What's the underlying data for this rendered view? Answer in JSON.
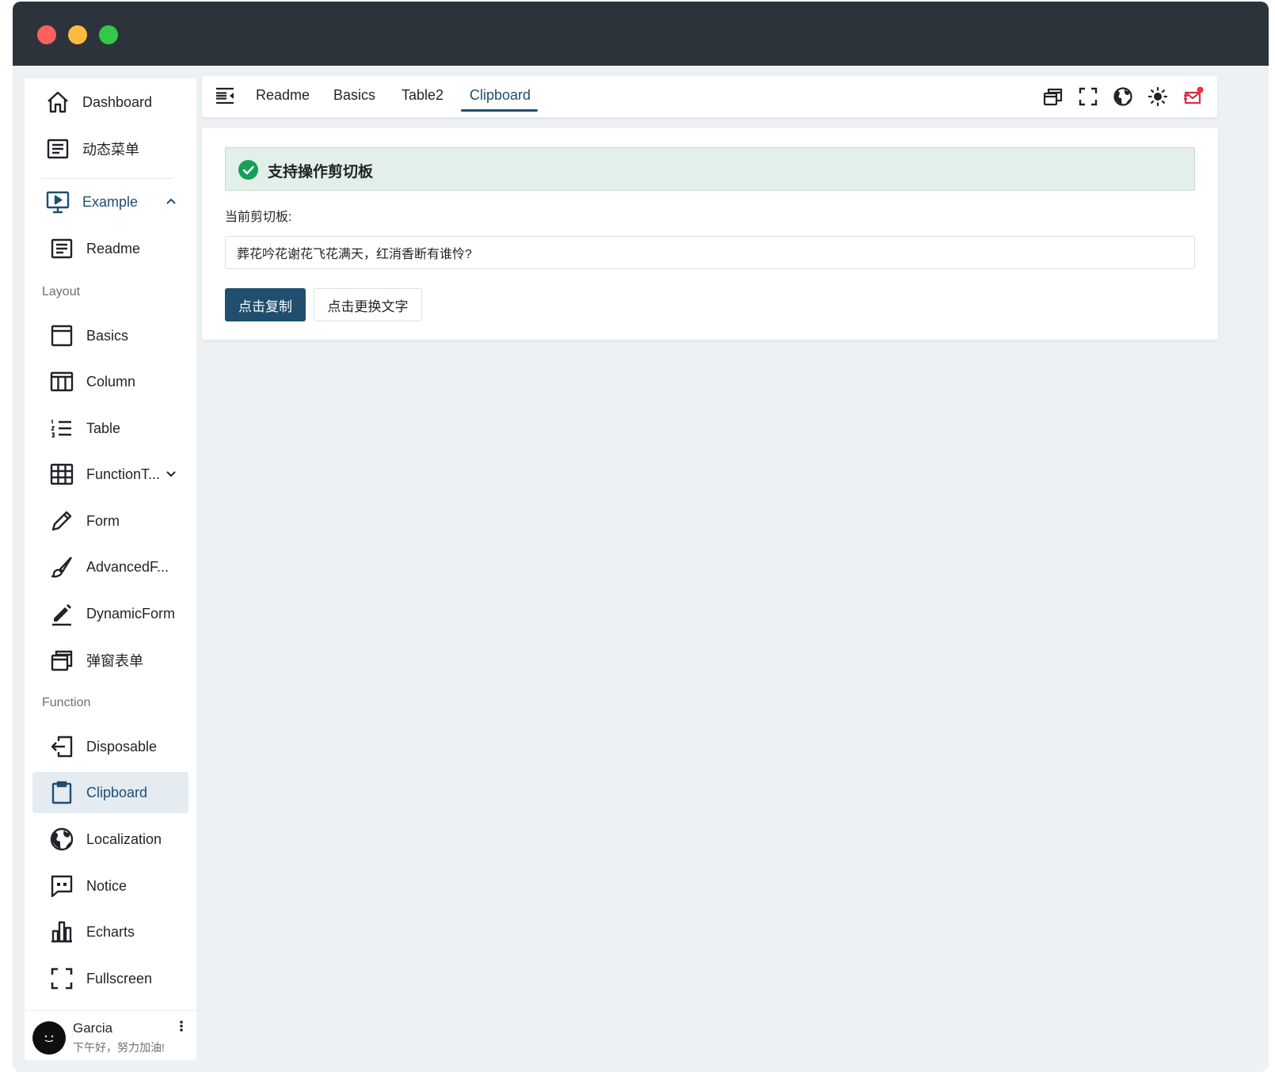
{
  "colors": {
    "accent": "#1f4e6e",
    "titlebar": "#2d333b",
    "background": "#edf1f4",
    "success": "#15a05a",
    "notify": "#e53935"
  },
  "sidebar": {
    "top_items": [
      {
        "label": "Dashboard",
        "icon": "home-icon"
      },
      {
        "label": "动态菜单",
        "icon": "document-icon"
      }
    ],
    "example": {
      "label": "Example",
      "icon": "presentation-icon",
      "expanded": true
    },
    "readme": {
      "label": "Readme",
      "icon": "document-icon"
    },
    "sections": {
      "layout": "Layout",
      "function": "Function"
    },
    "layout_items": [
      {
        "label": "Basics",
        "icon": "window-icon"
      },
      {
        "label": "Column",
        "icon": "columns-icon"
      },
      {
        "label": "Table",
        "icon": "numbered-list-icon"
      },
      {
        "label": "FunctionT...",
        "icon": "grid-icon"
      },
      {
        "label": "Form",
        "icon": "pencil-icon"
      },
      {
        "label": "AdvancedF...",
        "icon": "brush-icon"
      },
      {
        "label": "DynamicForm",
        "icon": "edit-icon"
      },
      {
        "label": "弹窗表单",
        "icon": "windows-icon"
      }
    ],
    "function_items": [
      {
        "label": "Disposable",
        "icon": "logout-icon"
      },
      {
        "label": "Clipboard",
        "icon": "clipboard-icon",
        "active": true
      },
      {
        "label": "Localization",
        "icon": "globe-icon"
      },
      {
        "label": "Notice",
        "icon": "message-icon"
      },
      {
        "label": "Echarts",
        "icon": "bar-chart-icon"
      },
      {
        "label": "Fullscreen",
        "icon": "fullscreen-icon"
      }
    ],
    "user": {
      "name": "Garcia",
      "greeting": "下午好，努力加油!"
    }
  },
  "topbar": {
    "tabs": [
      "Readme",
      "Basics",
      "Table2",
      "Clipboard"
    ],
    "active_tab": "Clipboard",
    "tools": [
      "windows-icon",
      "fullscreen-icon",
      "globe-icon",
      "sun-icon",
      "mail-icon"
    ]
  },
  "main": {
    "alert": "支持操作剪切板",
    "label": "当前剪切板:",
    "input_value": "葬花吟花谢花飞花满天，红消香断有谁怜?",
    "copy_button": "点击复制",
    "change_button": "点击更换文字"
  }
}
